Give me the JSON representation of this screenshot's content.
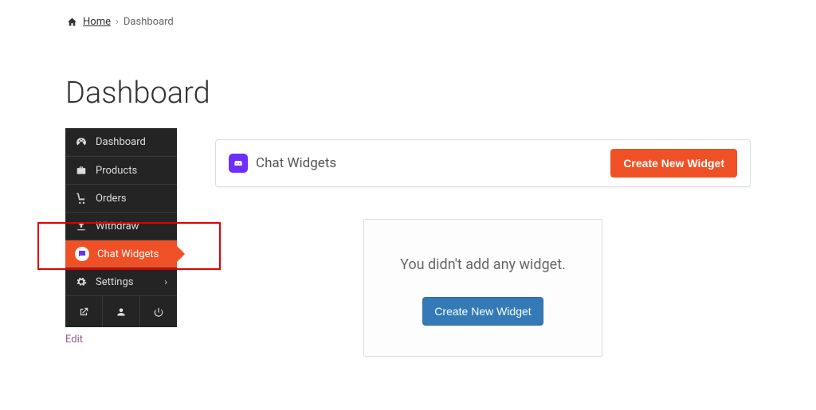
{
  "breadcrumb": {
    "home_label": "Home",
    "current": "Dashboard"
  },
  "page_title": "Dashboard",
  "sidebar": {
    "items": [
      {
        "label": "Dashboard"
      },
      {
        "label": "Products"
      },
      {
        "label": "Orders"
      },
      {
        "label": "Withdraw"
      },
      {
        "label": "Chat Widgets"
      },
      {
        "label": "Settings"
      }
    ],
    "edit_label": "Edit"
  },
  "header_card": {
    "title": "Chat Widgets",
    "create_button": "Create New Widget"
  },
  "empty_state": {
    "message": "You didn't add any widget.",
    "button": "Create New Widget"
  }
}
